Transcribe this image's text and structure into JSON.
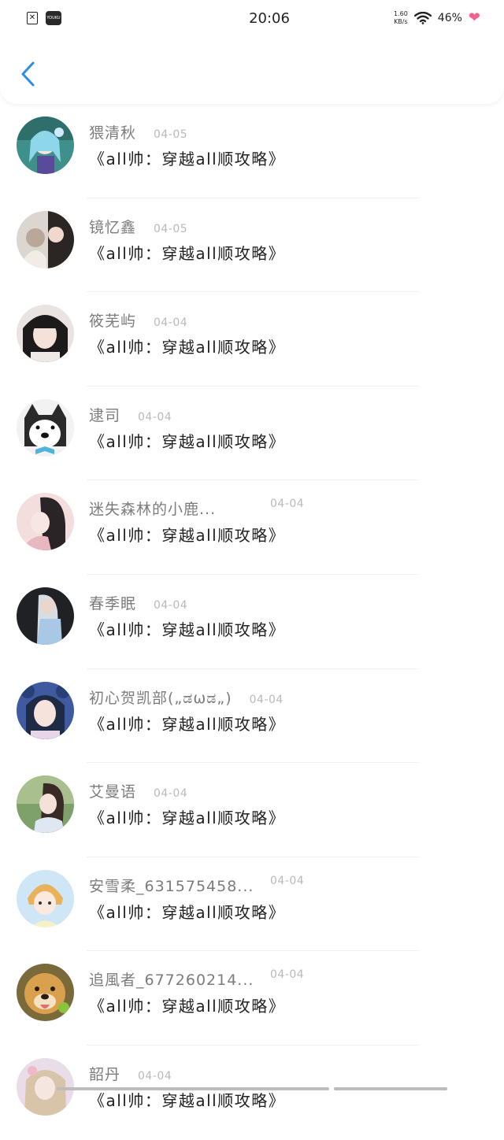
{
  "status_bar": {
    "time": "20:06",
    "net_speed_value": "1.60",
    "net_speed_unit": "KB/s",
    "battery": "46%",
    "youku_label": "YOUKU"
  },
  "nav": {
    "back_icon": "chevron-left-icon",
    "accent_color": "#2a8ee6"
  },
  "items": [
    {
      "name": "猥清秋",
      "date": "04-05",
      "message": "《all帅：穿越all顺攻略》",
      "far_date": false
    },
    {
      "name": "镜忆鑫",
      "date": "04-05",
      "message": "《all帅：穿越all顺攻略》",
      "far_date": false
    },
    {
      "name": "筱芜屿",
      "date": "04-04",
      "message": "《all帅：穿越all顺攻略》",
      "far_date": false
    },
    {
      "name": "逮司",
      "date": "04-04",
      "message": "《all帅：穿越all顺攻略》",
      "far_date": false
    },
    {
      "name": "迷失森林的小鹿...",
      "date": "04-04",
      "message": "《all帅：穿越all顺攻略》",
      "far_date": true
    },
    {
      "name": "春季眠",
      "date": "04-04",
      "message": "《all帅：穿越all顺攻略》",
      "far_date": false
    },
    {
      "name": "初心贺凯部(„ಡωಡ„)",
      "date": "04-04",
      "message": "《all帅：穿越all顺攻略》",
      "far_date": false
    },
    {
      "name": "艾曼语",
      "date": "04-04",
      "message": "《all帅：穿越all顺攻略》",
      "far_date": false
    },
    {
      "name": "安雪柔_631575458...",
      "date": "04-04",
      "message": "《all帅：穿越all顺攻略》",
      "far_date": true
    },
    {
      "name": "追風者_677260214...",
      "date": "04-04",
      "message": "《all帅：穿越all顺攻略》",
      "far_date": true
    },
    {
      "name": "韶丹",
      "date": "04-04",
      "message": "《all帅：穿越all顺攻略》",
      "far_date": false
    }
  ]
}
